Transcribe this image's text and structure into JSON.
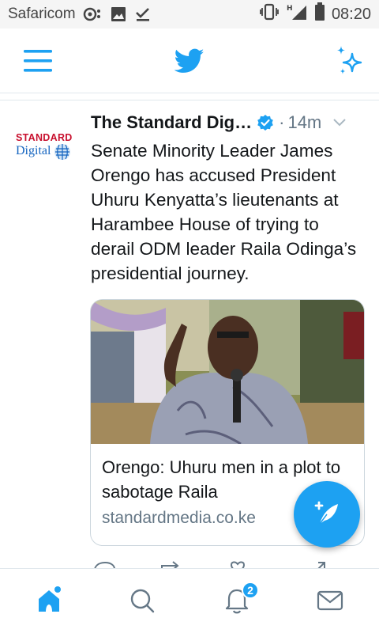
{
  "status_bar": {
    "carrier": "Safaricom",
    "time": "08:20",
    "icons": [
      "notification-icon",
      "image-icon",
      "download-done-icon",
      "vibrate-icon",
      "signal-icon",
      "battery-icon"
    ]
  },
  "app_bar": {
    "icons": [
      "menu-icon",
      "twitter-bird-icon",
      "sparkle-icon"
    ]
  },
  "tweet": {
    "avatar_line1": "STANDARD",
    "avatar_line2": "Digital",
    "author_name": "The Standard Dig…",
    "separator": "·",
    "time": "14m",
    "text": "Senate Minority Leader James Orengo has accused President Uhuru Kenyatta’s lieutenants at Harambee House of trying to derail ODM leader Raila Odinga’s presidential journey.",
    "card_title": "Orengo: Uhuru men in a plot to sabotage Raila",
    "card_domain": "standardmedia.co.ke"
  },
  "bottom_nav": {
    "notification_count": "2",
    "items": [
      "home-icon",
      "search-icon",
      "notifications-icon",
      "messages-icon"
    ]
  },
  "colors": {
    "accent": "#1da1f2",
    "secondary_text": "#657786",
    "divider": "#e1e8ed"
  }
}
